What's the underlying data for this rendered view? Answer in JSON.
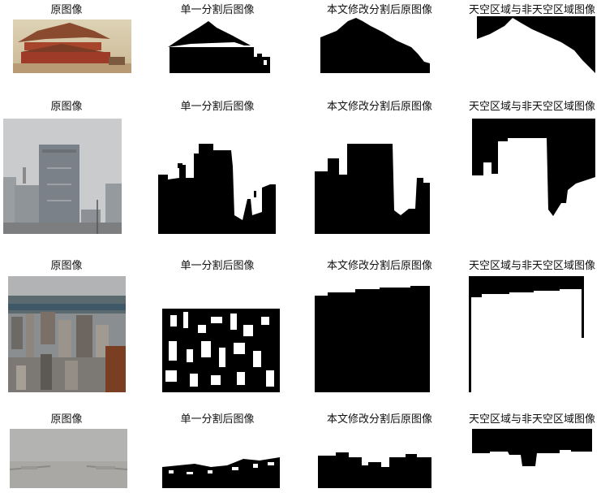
{
  "header_labels": {
    "original": "原图像",
    "single_seg": "单一分割后图像",
    "modified_seg": "本文修改分割后原图像",
    "sky_region": "天空区域与非天空区域图像"
  },
  "rows": [
    {
      "id": "row-1"
    },
    {
      "id": "row-2"
    },
    {
      "id": "row-3"
    },
    {
      "id": "row-4"
    }
  ]
}
